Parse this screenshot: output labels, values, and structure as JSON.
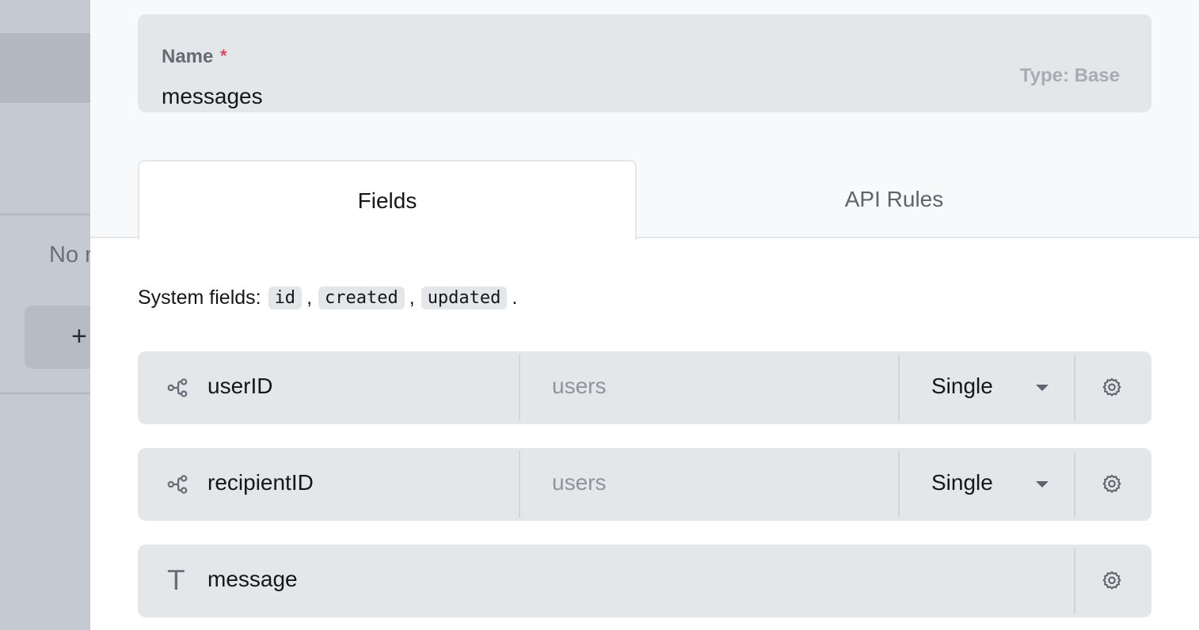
{
  "background": {
    "empty_text": "No r",
    "add_button_label": "+"
  },
  "collection": {
    "name_label": "Name",
    "required_marker": "*",
    "name_value": "messages",
    "type_label": "Type: Base"
  },
  "tabs": [
    {
      "label": "Fields",
      "active": true
    },
    {
      "label": "API Rules",
      "active": false
    }
  ],
  "system_fields": {
    "prefix": "System fields:",
    "fields": [
      "id",
      "created",
      "updated"
    ],
    "separator": ",",
    "suffix": "."
  },
  "fields": [
    {
      "icon": "relation-icon",
      "name": "userID",
      "collection": "users",
      "mode": "Single"
    },
    {
      "icon": "relation-icon",
      "name": "recipientID",
      "collection": "users",
      "mode": "Single"
    },
    {
      "icon": "text-icon",
      "icon_glyph": "T",
      "name": "message"
    }
  ],
  "colors": {
    "required": "#e34562",
    "field_bg": "#e4e7ea",
    "overlay": "#c5c9d1"
  }
}
